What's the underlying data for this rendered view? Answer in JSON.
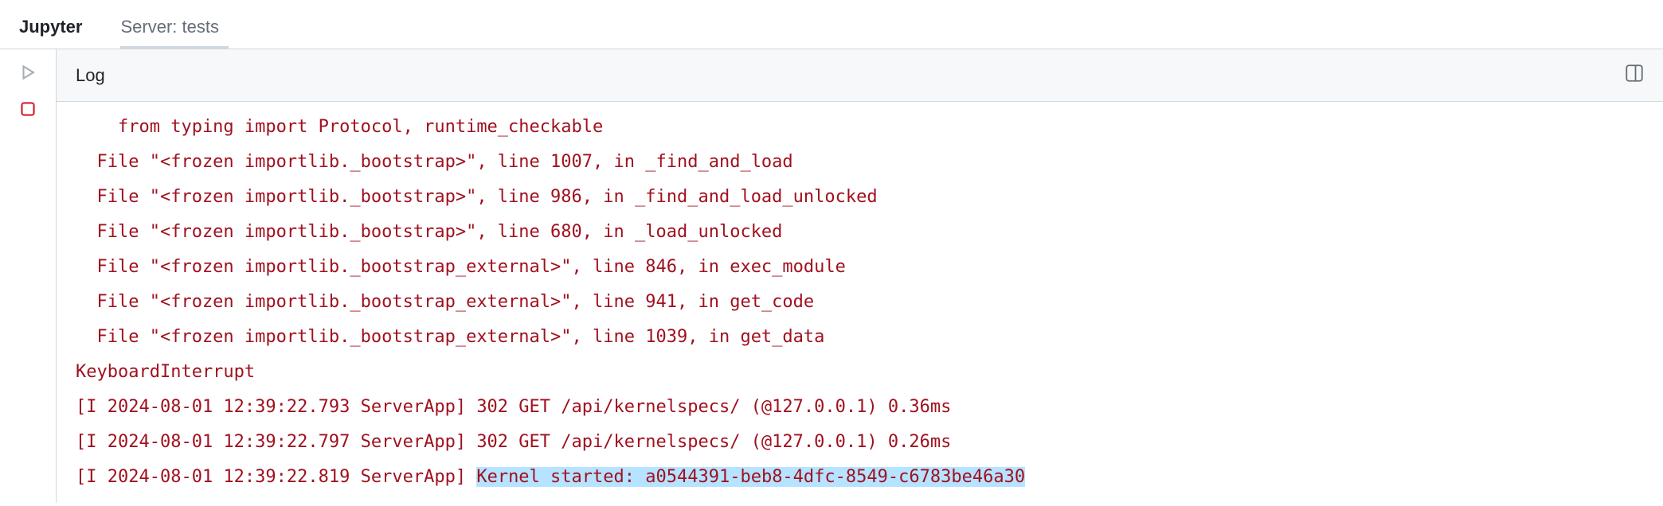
{
  "tabs": {
    "jupyter": "Jupyter",
    "server": "Server: tests"
  },
  "log": {
    "title": "Log",
    "lines": [
      {
        "text": "    from typing import Protocol, runtime_checkable",
        "kind": "err",
        "indent": 0
      },
      {
        "text": "  File \"<frozen importlib._bootstrap>\", line 1007, in _find_and_load",
        "kind": "err",
        "indent": 0
      },
      {
        "text": "  File \"<frozen importlib._bootstrap>\", line 986, in _find_and_load_unlocked",
        "kind": "err",
        "indent": 0
      },
      {
        "text": "  File \"<frozen importlib._bootstrap>\", line 680, in _load_unlocked",
        "kind": "err",
        "indent": 0
      },
      {
        "text": "  File \"<frozen importlib._bootstrap_external>\", line 846, in exec_module",
        "kind": "err",
        "indent": 0
      },
      {
        "text": "  File \"<frozen importlib._bootstrap_external>\", line 941, in get_code",
        "kind": "err",
        "indent": 0
      },
      {
        "text": "  File \"<frozen importlib._bootstrap_external>\", line 1039, in get_data",
        "kind": "err",
        "indent": 0
      },
      {
        "text": "KeyboardInterrupt",
        "kind": "err",
        "indent": 0
      },
      {
        "text": "[I 2024-08-01 12:39:22.793 ServerApp] 302 GET /api/kernelspecs/ (@127.0.0.1) 0.36ms",
        "kind": "err",
        "indent": 0
      },
      {
        "text": "[I 2024-08-01 12:39:22.797 ServerApp] 302 GET /api/kernelspecs/ (@127.0.0.1) 0.26ms",
        "kind": "err",
        "indent": 0
      },
      {
        "prefix": "[I 2024-08-01 12:39:22.819 ServerApp] ",
        "highlight": "Kernel started: a0544391-beb8-4dfc-8549-c6783be46a30",
        "kind": "err-split",
        "indent": 0
      }
    ]
  }
}
